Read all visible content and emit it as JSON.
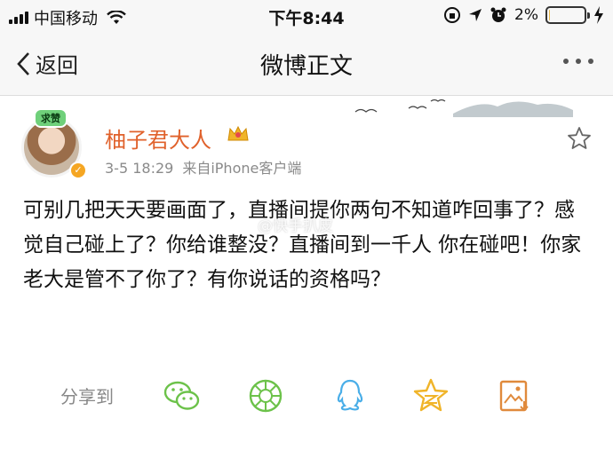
{
  "status_bar": {
    "carrier": "中国移动",
    "time": "下午8:44",
    "battery": "2%",
    "battery_level": 0.02
  },
  "nav": {
    "back_label": "返回",
    "title": "微博正文"
  },
  "post": {
    "avatar_badge": "求赞",
    "username": "柚子君大人",
    "timestamp": "3-5 18:29",
    "source": "来自iPhone客户端",
    "content": "可别几把天天要画面了，直播间提你两句不知道咋回事了？感觉自己碰上了？你给谁整没？直播间到一千人 你在碰吧！你家老大是管不了你了？有你说话的资格吗？"
  },
  "share": {
    "label": "分享到",
    "icons": [
      "wechat-icon",
      "moments-icon",
      "qq-icon",
      "qzone-icon",
      "save-image-icon"
    ],
    "color": "#6cc24a"
  },
  "watermark": "@快手扒皮",
  "colors": {
    "username": "#e0612b",
    "share_green": "#6cc24a"
  }
}
